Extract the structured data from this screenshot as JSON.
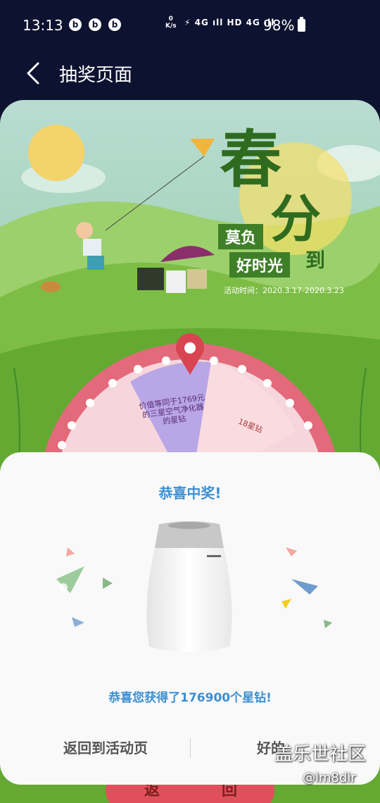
{
  "status_bar": {
    "time": "13:13",
    "net_speed_value": "0",
    "net_speed_unit": "K/s",
    "signal_text": "⚡ 4G ıll HD 4G ıll",
    "battery": "98%"
  },
  "header": {
    "title": "抽奖页面",
    "back_icon": "chevron-left-icon"
  },
  "background_page": {
    "poster_title_1": "春",
    "poster_title_2": "分",
    "tag_1": "莫负",
    "tag_2": "好时光",
    "tag_3": "到",
    "date": "活动时间：2020.3.17-2020.3.23",
    "wheel_label_1": "价值等同于1769元的三星空气净化器的星钻",
    "wheel_label_2": "18星钻",
    "bottom_left": "返",
    "bottom_right": "回"
  },
  "dialog": {
    "title": "恭喜中奖!",
    "product_image": "samsung-air-purifier",
    "message": "恭喜您获得了176900个星钻!",
    "return_button": "返回到活动页",
    "ok_button": "好的"
  },
  "watermark": {
    "main": "盖乐世社区",
    "sub": "@lm8dir"
  },
  "colors": {
    "accent": "#3d8fd1",
    "status_bar_bg": "#0d1230",
    "dialog_bg": "#f9f9f9"
  }
}
